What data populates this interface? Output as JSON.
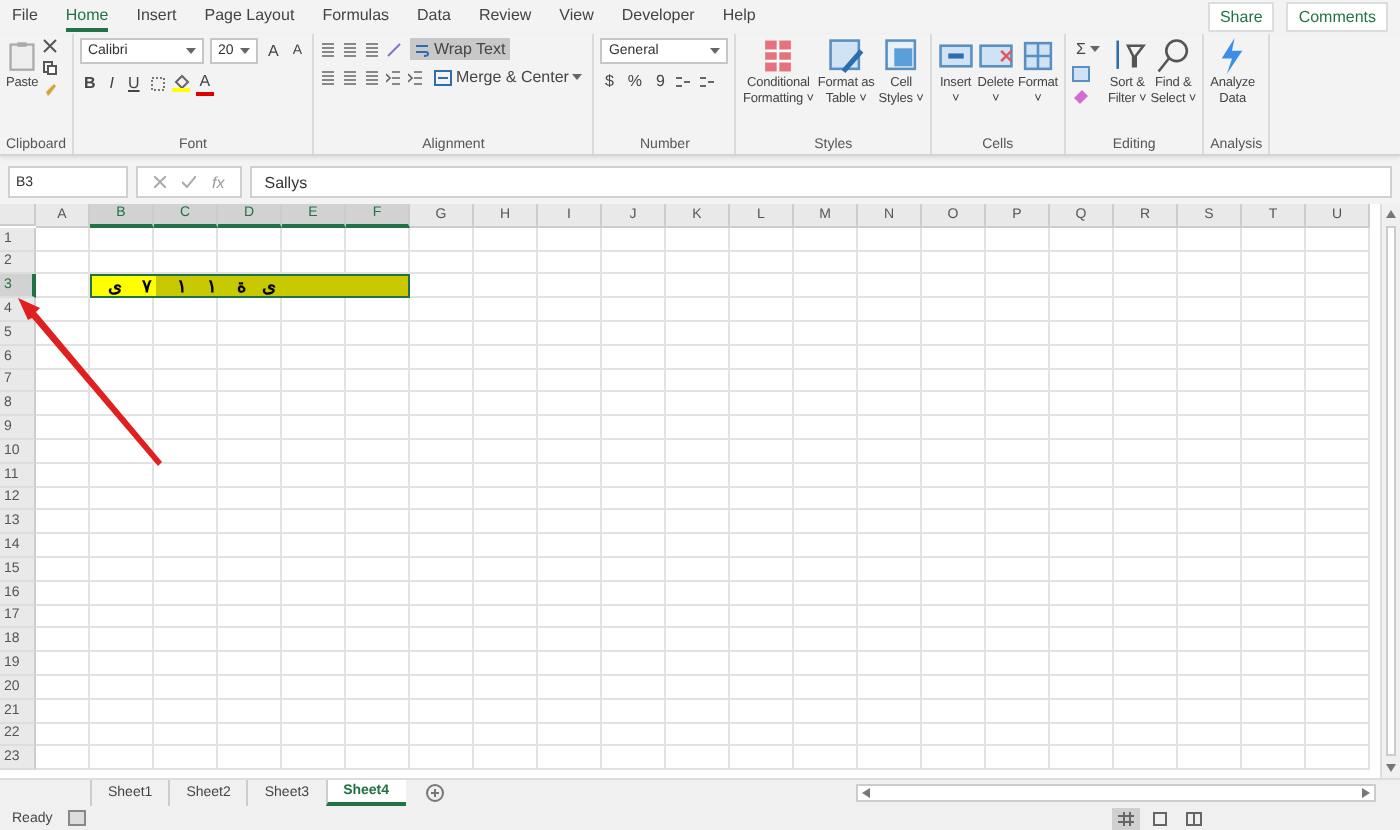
{
  "menu_tabs": [
    {
      "label": "File",
      "selected": false
    },
    {
      "label": "Home",
      "selected": true
    },
    {
      "label": "Insert",
      "selected": false
    },
    {
      "label": "Page Layout",
      "selected": false
    },
    {
      "label": "Formulas",
      "selected": false
    },
    {
      "label": "Data",
      "selected": false
    },
    {
      "label": "Review",
      "selected": false
    },
    {
      "label": "View",
      "selected": false
    },
    {
      "label": "Developer",
      "selected": false
    },
    {
      "label": "Help",
      "selected": false
    }
  ],
  "share": "Share",
  "comments": "Comments",
  "ribbon": [
    {
      "kind": "clipboard",
      "label": "Clipboard",
      "paste": "Paste"
    },
    {
      "kind": "font",
      "label": "Font",
      "font_name": "Calibri",
      "font_size": "20",
      "grow": "A",
      "shrink": "A",
      "styles": [
        "B",
        "I",
        "U"
      ],
      "color_glyph": "A"
    },
    {
      "kind": "alignment",
      "label": "Alignment",
      "wrap": "Wrap Text",
      "wrap_on": true,
      "merge": "Merge & Center"
    },
    {
      "kind": "number",
      "label": "Number",
      "format": "General",
      "glyphs": [
        "$",
        "%",
        "9"
      ]
    },
    {
      "kind": "large",
      "label": "Styles",
      "buttons": [
        {
          "kind": "conditional",
          "lines": [
            "Conditional",
            "Formatting ˅"
          ]
        },
        {
          "kind": "table",
          "lines": [
            "Format as",
            "Table ˅"
          ]
        },
        {
          "kind": "styles",
          "lines": [
            "Cell",
            "Styles ˅"
          ]
        }
      ]
    },
    {
      "kind": "large",
      "label": "Cells",
      "buttons": [
        {
          "kind": "insert",
          "lines": [
            "Insert",
            "˅"
          ]
        },
        {
          "kind": "delete",
          "lines": [
            "Delete",
            "˅"
          ]
        },
        {
          "kind": "format",
          "lines": [
            "Format",
            "˅"
          ]
        }
      ]
    },
    {
      "kind": "editing",
      "label": "Editing",
      "sigma": "Σ",
      "buttons": [
        {
          "kind": "sort",
          "lines": [
            "Sort &",
            "Filter ˅"
          ]
        },
        {
          "kind": "find",
          "lines": [
            "Find &",
            "Select ˅"
          ]
        }
      ]
    },
    {
      "kind": "large",
      "label": "Analysis",
      "buttons": [
        {
          "kind": "analyze",
          "lines": [
            "Analyze",
            "Data"
          ]
        }
      ]
    }
  ],
  "formula_bar": {
    "name_box": "B3",
    "fx": "fx",
    "value": "Sallys"
  },
  "grid": {
    "columns": [
      {
        "label": "A",
        "selected": false,
        "active": false
      },
      {
        "label": "B",
        "selected": true,
        "active": true
      },
      {
        "label": "C",
        "selected": true,
        "active": false
      },
      {
        "label": "D",
        "selected": true,
        "active": false
      },
      {
        "label": "E",
        "selected": true,
        "active": false
      },
      {
        "label": "F",
        "selected": true,
        "active": false
      },
      {
        "label": "G",
        "selected": false,
        "active": false
      },
      {
        "label": "H",
        "selected": false,
        "active": false
      },
      {
        "label": "I",
        "selected": false,
        "active": false
      },
      {
        "label": "J",
        "selected": false,
        "active": false
      },
      {
        "label": "K",
        "selected": false,
        "active": false
      },
      {
        "label": "L",
        "selected": false,
        "active": false
      },
      {
        "label": "M",
        "selected": false,
        "active": false
      },
      {
        "label": "N",
        "selected": false,
        "active": false
      },
      {
        "label": "O",
        "selected": false,
        "active": false
      },
      {
        "label": "P",
        "selected": false,
        "active": false
      },
      {
        "label": "Q",
        "selected": false,
        "active": false
      },
      {
        "label": "R",
        "selected": false,
        "active": false
      },
      {
        "label": "S",
        "selected": false,
        "active": false
      },
      {
        "label": "T",
        "selected": false,
        "active": false
      },
      {
        "label": "U",
        "selected": false,
        "active": false
      }
    ],
    "rows": [
      {
        "label": "1",
        "selected": false
      },
      {
        "label": "2",
        "selected": false
      },
      {
        "label": "3",
        "selected": true,
        "text": "ى   ة    ١    ١     ٧    ى"
      },
      {
        "label": "4",
        "selected": false
      },
      {
        "label": "5",
        "selected": false
      },
      {
        "label": "6",
        "selected": false
      },
      {
        "label": "7",
        "selected": false
      },
      {
        "label": "8",
        "selected": false
      },
      {
        "label": "9",
        "selected": false
      },
      {
        "label": "10",
        "selected": false
      },
      {
        "label": "11",
        "selected": false
      },
      {
        "label": "12",
        "selected": false
      },
      {
        "label": "13",
        "selected": false
      },
      {
        "label": "14",
        "selected": false
      },
      {
        "label": "15",
        "selected": false
      },
      {
        "label": "16",
        "selected": false
      },
      {
        "label": "17",
        "selected": false
      },
      {
        "label": "18",
        "selected": false
      },
      {
        "label": "19",
        "selected": false
      },
      {
        "label": "20",
        "selected": false
      },
      {
        "label": "21",
        "selected": false
      },
      {
        "label": "22",
        "selected": false
      },
      {
        "label": "23",
        "selected": false
      }
    ]
  },
  "sheet_tabs": [
    {
      "label": "Sheet1",
      "selected": false
    },
    {
      "label": "Sheet2",
      "selected": false
    },
    {
      "label": "Sheet3",
      "selected": false
    },
    {
      "label": "Sheet4",
      "selected": true
    }
  ],
  "status": "Ready",
  "view_modes": [
    {
      "kind": "normal",
      "selected": true
    },
    {
      "kind": "page_layout",
      "selected": false
    },
    {
      "kind": "page_break",
      "selected": false
    }
  ]
}
